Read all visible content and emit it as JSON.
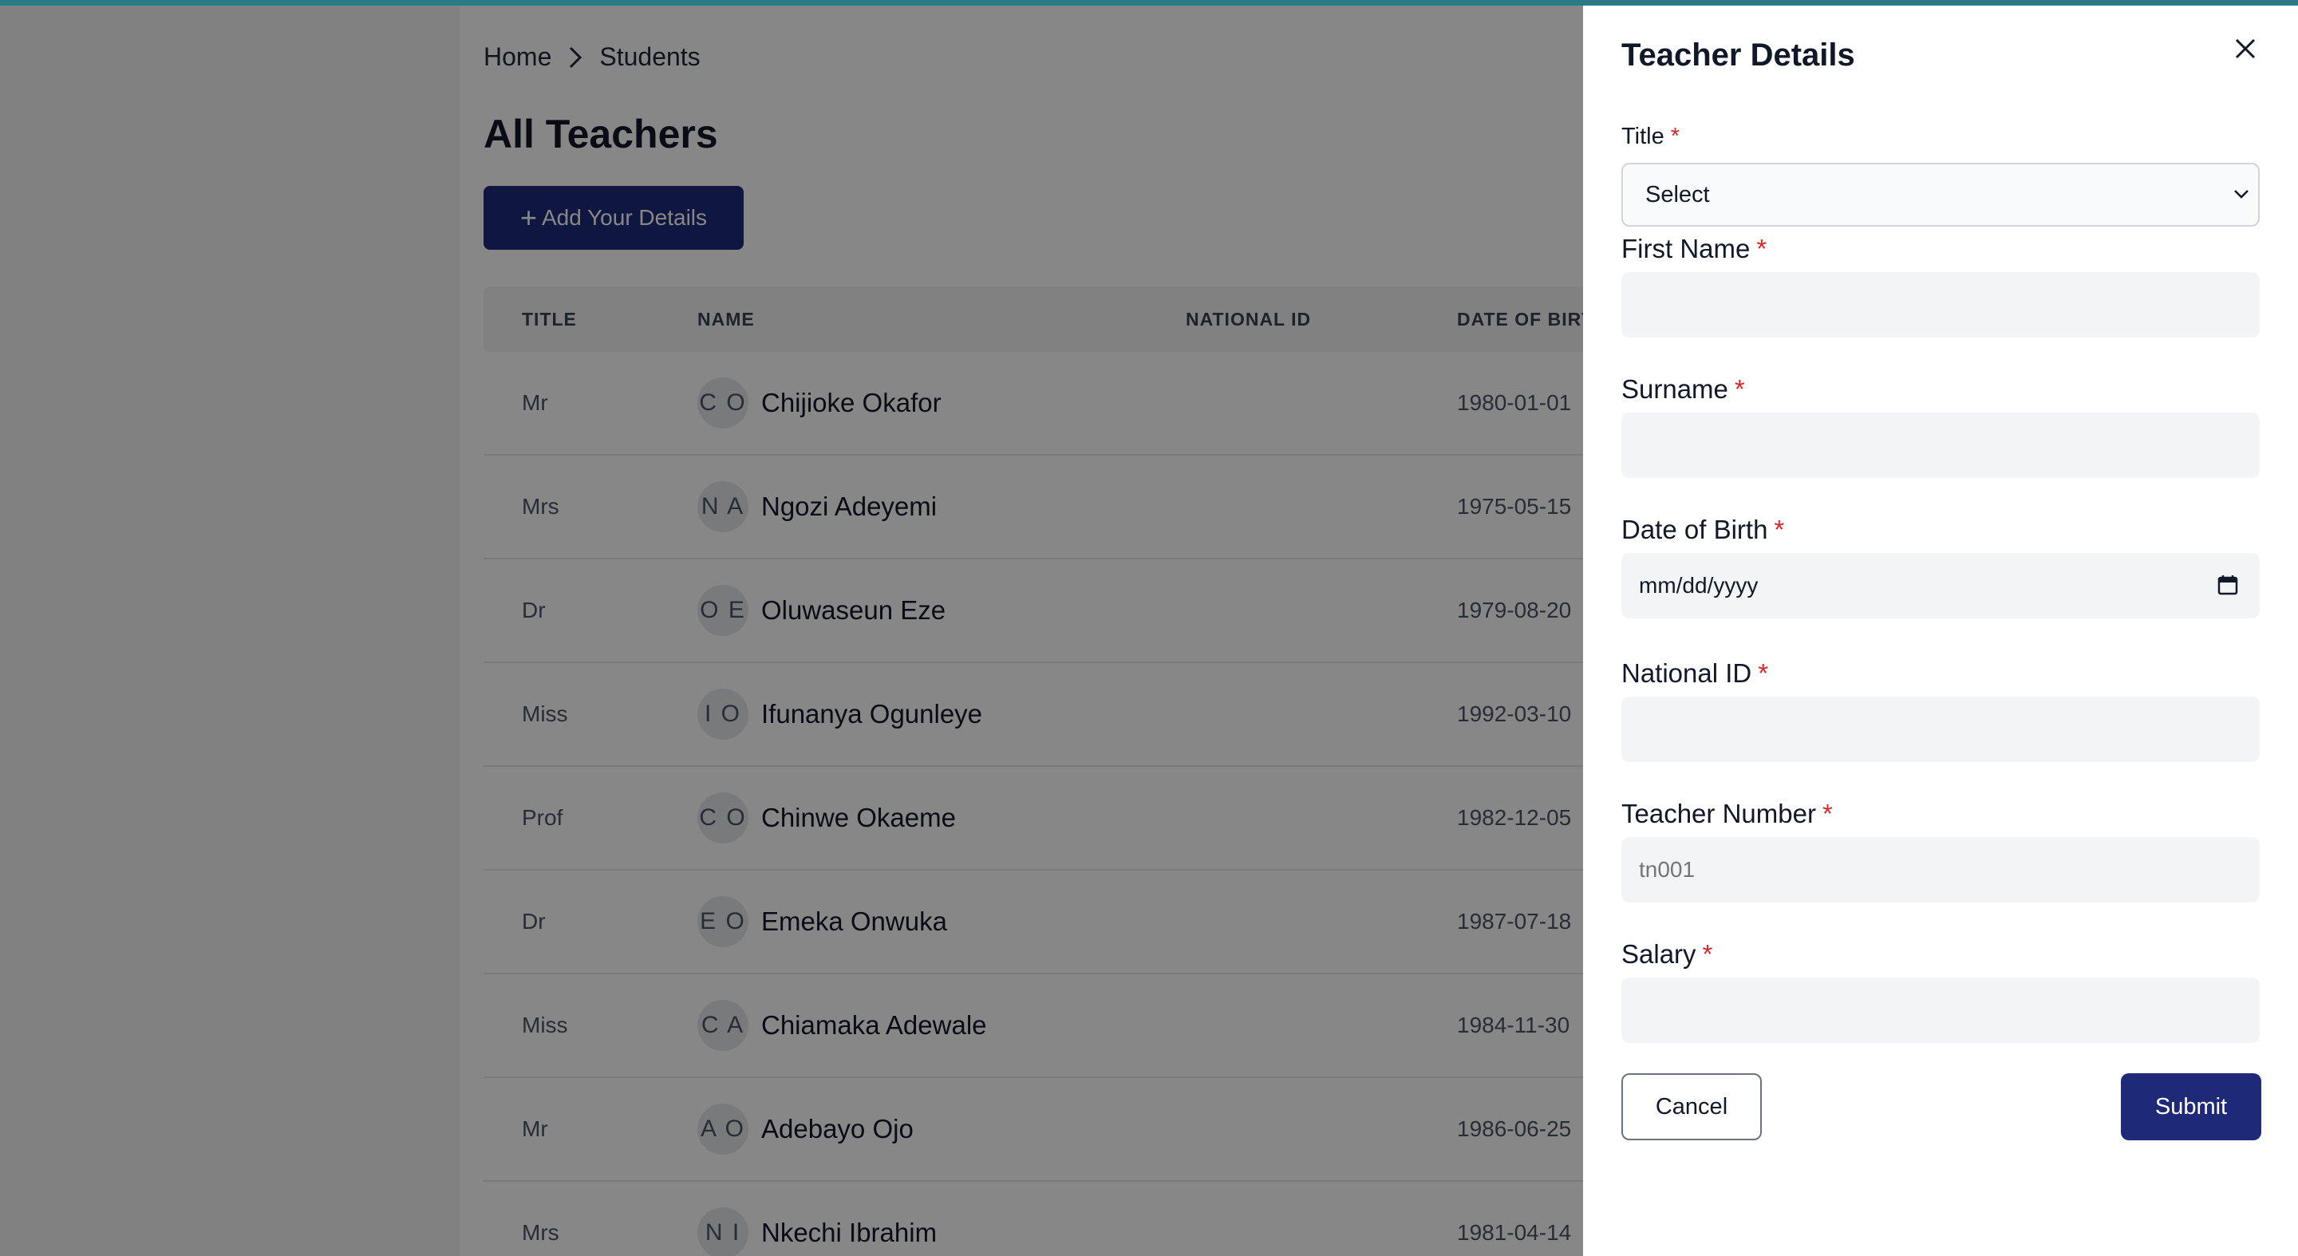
{
  "breadcrumb": {
    "home": "Home",
    "current": "Students"
  },
  "page": {
    "title": "All Teachers",
    "add_button": "Add Your Details"
  },
  "table": {
    "headers": {
      "title": "TITLE",
      "name": "NAME",
      "national_id": "NATIONAL ID",
      "dob": "DATE OF BIRT"
    },
    "rows": [
      {
        "title": "Mr",
        "initials": "C O",
        "name": "Chijioke Okafor",
        "dob": "1980-01-01"
      },
      {
        "title": "Mrs",
        "initials": "N A",
        "name": "Ngozi Adeyemi",
        "dob": "1975-05-15"
      },
      {
        "title": "Dr",
        "initials": "O E",
        "name": "Oluwaseun Eze",
        "dob": "1979-08-20"
      },
      {
        "title": "Miss",
        "initials": "I O",
        "name": "Ifunanya Ogunleye",
        "dob": "1992-03-10"
      },
      {
        "title": "Prof",
        "initials": "C O",
        "name": "Chinwe Okaeme",
        "dob": "1982-12-05"
      },
      {
        "title": "Dr",
        "initials": "E O",
        "name": "Emeka Onwuka",
        "dob": "1987-07-18"
      },
      {
        "title": "Miss",
        "initials": "C A",
        "name": "Chiamaka Adewale",
        "dob": "1984-11-30"
      },
      {
        "title": "Mr",
        "initials": "A O",
        "name": "Adebayo Ojo",
        "dob": "1986-06-25"
      },
      {
        "title": "Mrs",
        "initials": "N I",
        "name": "Nkechi Ibrahim",
        "dob": "1981-04-14"
      }
    ]
  },
  "drawer": {
    "title": "Teacher Details",
    "required_mark": "*",
    "fields": {
      "title": {
        "label": "Title",
        "value": "Select"
      },
      "first_name": {
        "label": "First Name"
      },
      "surname": {
        "label": "Surname"
      },
      "dob": {
        "label": "Date of Birth",
        "value": "mm/dd/yyyy"
      },
      "national_id": {
        "label": "National ID"
      },
      "teacher_number": {
        "label": "Teacher Number",
        "placeholder": "tn001"
      },
      "salary": {
        "label": "Salary"
      }
    },
    "cancel_label": "Cancel",
    "submit_label": "Submit"
  },
  "colors": {
    "accent": "#1e2a78",
    "topbar": "#2b7a8a",
    "required": "#dc2626"
  },
  "icons": [
    "chevron-right-icon",
    "plus-icon",
    "close-icon",
    "chevron-down-icon",
    "calendar-icon"
  ]
}
